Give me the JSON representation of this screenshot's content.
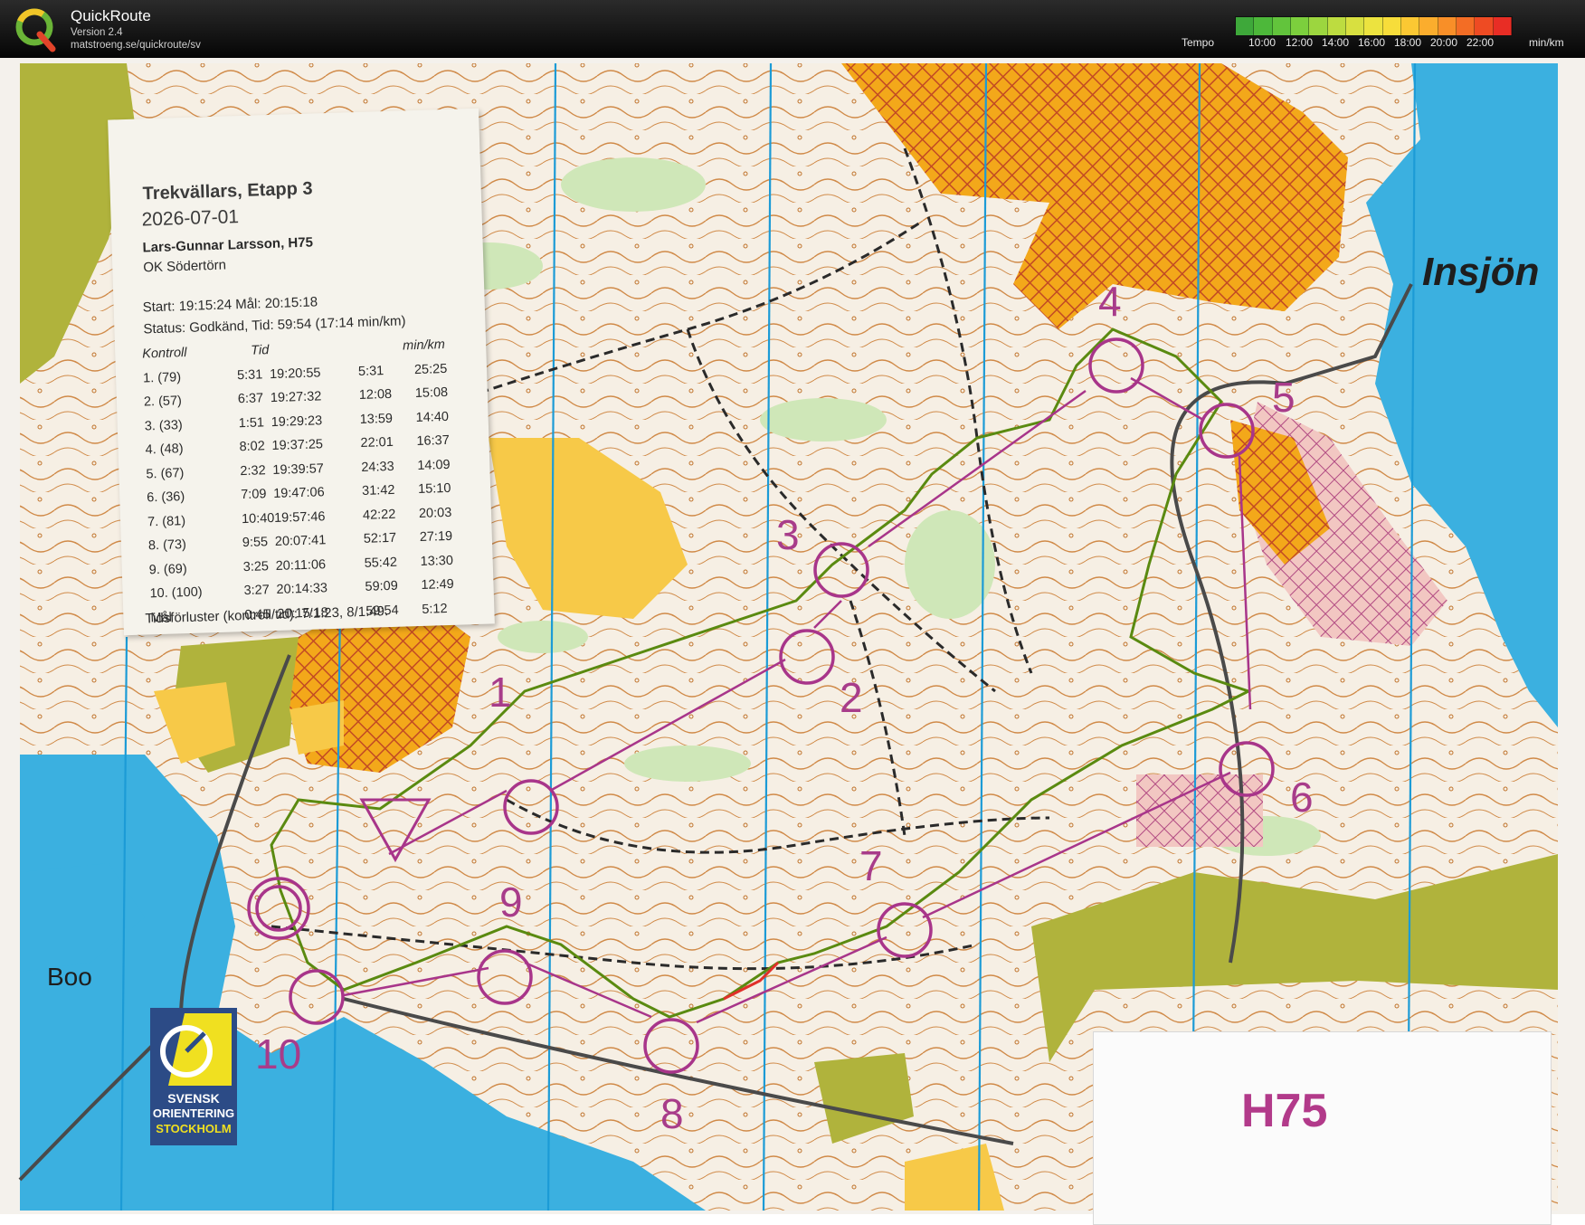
{
  "header": {
    "app_name": "QuickRoute",
    "version": "Version 2.4",
    "url": "matstroeng.se/quickroute/sv",
    "tempo_label": "Tempo",
    "tempo_unit": "min/km",
    "tempo_ticks": [
      "10:00",
      "12:00",
      "14:00",
      "16:00",
      "18:00",
      "20:00",
      "22:00"
    ],
    "tempo_colors": [
      "#3ea83a",
      "#4db83a",
      "#62c43c",
      "#7ccf3d",
      "#9cd63f",
      "#bddc40",
      "#d8e040",
      "#ece33f",
      "#f7dd3a",
      "#fbc833",
      "#fbad2d",
      "#f88f28",
      "#f36d25",
      "#ee4b23",
      "#e82d25"
    ]
  },
  "info": {
    "race": "Trekvällars, Etapp 3",
    "date": "2026-07-01",
    "runner": "Lars-Gunnar Larsson, H75",
    "club": "OK Södertörn",
    "start_finish": "Start: 19:15:24  Mål: 20:15:18",
    "status": "Status: Godkänd, Tid: 59:54 (17:14 min/km)",
    "columns": {
      "control": "Kontroll",
      "time": "Tid",
      "pace": "min/km"
    },
    "splits": [
      {
        "control": "1.   (79)",
        "leg": "5:31",
        "clock": "19:20:55",
        "total": "5:31",
        "pace": "25:25"
      },
      {
        "control": "2.   (57)",
        "leg": "6:37",
        "clock": "19:27:32",
        "total": "12:08",
        "pace": "15:08"
      },
      {
        "control": "3.   (33)",
        "leg": "1:51",
        "clock": "19:29:23",
        "total": "13:59",
        "pace": "14:40"
      },
      {
        "control": "4.   (48)",
        "leg": "8:02",
        "clock": "19:37:25",
        "total": "22:01",
        "pace": "16:37"
      },
      {
        "control": "5.   (67)",
        "leg": "2:32",
        "clock": "19:39:57",
        "total": "24:33",
        "pace": "14:09"
      },
      {
        "control": "6.   (36)",
        "leg": "7:09",
        "clock": "19:47:06",
        "total": "31:42",
        "pace": "15:10"
      },
      {
        "control": "7.   (81)",
        "leg": "10:40",
        "clock": "19:57:46",
        "total": "42:22",
        "pace": "20:03"
      },
      {
        "control": "8.   (73)",
        "leg": "9:55",
        "clock": "20:07:41",
        "total": "52:17",
        "pace": "27:19"
      },
      {
        "control": "9.   (69)",
        "leg": "3:25",
        "clock": "20:11:06",
        "total": "55:42",
        "pace": "13:30"
      },
      {
        "control": "10.  (100)",
        "leg": "3:27",
        "clock": "20:14:33",
        "total": "59:09",
        "pace": "12:49"
      },
      {
        "control": "Mål",
        "leg": "0:45",
        "clock": "20:15:18",
        "total": "59:54",
        "pace": "5:12"
      }
    ],
    "losses": "Tidsförluster (kontroll/tid): 7/1:23, 8/1:49."
  },
  "map": {
    "lake_name": "Insjön",
    "place_name": "Boo",
    "class_name": "H75",
    "control_numbers": [
      "1",
      "2",
      "3",
      "4",
      "5",
      "6",
      "7",
      "8",
      "9",
      "10"
    ],
    "logo_lines": [
      "SVENSK",
      "ORIENTERING",
      "STOCKHOLM"
    ],
    "colors": {
      "course": "#a8358a",
      "water": "#3bb0e0",
      "settlement": "#f3a81a",
      "open_land": "#f7c948",
      "green_land": "#b0b33c",
      "contour": "#c0732b",
      "route": "#5a8a10"
    }
  }
}
